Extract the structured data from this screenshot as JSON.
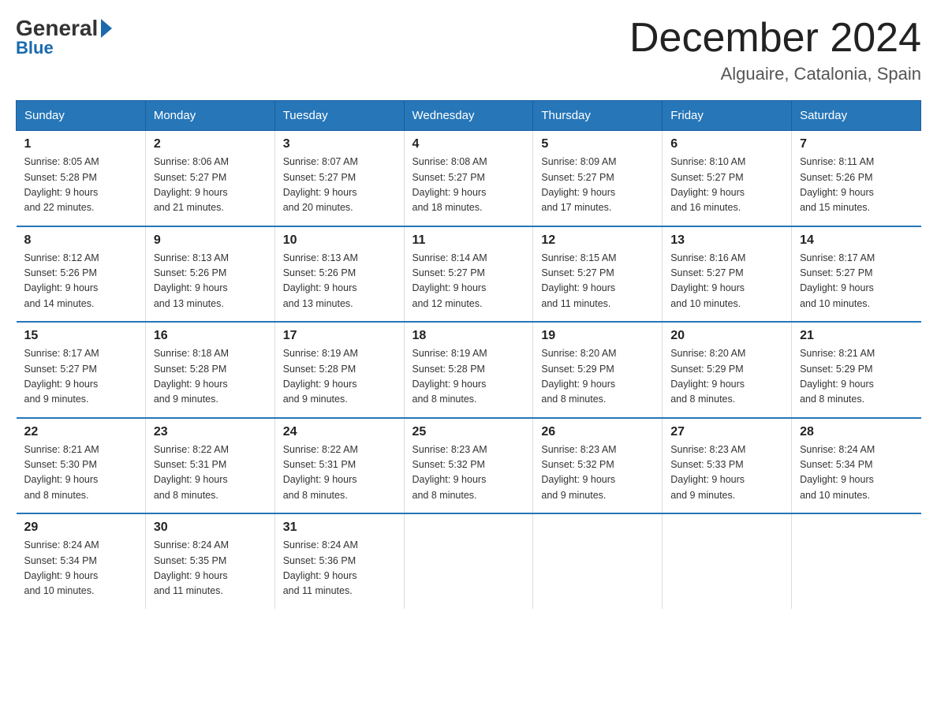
{
  "logo": {
    "general": "General",
    "blue": "Blue"
  },
  "title": "December 2024",
  "location": "Alguaire, Catalonia, Spain",
  "days_of_week": [
    "Sunday",
    "Monday",
    "Tuesday",
    "Wednesday",
    "Thursday",
    "Friday",
    "Saturday"
  ],
  "weeks": [
    [
      {
        "num": "1",
        "info": "Sunrise: 8:05 AM\nSunset: 5:28 PM\nDaylight: 9 hours\nand 22 minutes."
      },
      {
        "num": "2",
        "info": "Sunrise: 8:06 AM\nSunset: 5:27 PM\nDaylight: 9 hours\nand 21 minutes."
      },
      {
        "num": "3",
        "info": "Sunrise: 8:07 AM\nSunset: 5:27 PM\nDaylight: 9 hours\nand 20 minutes."
      },
      {
        "num": "4",
        "info": "Sunrise: 8:08 AM\nSunset: 5:27 PM\nDaylight: 9 hours\nand 18 minutes."
      },
      {
        "num": "5",
        "info": "Sunrise: 8:09 AM\nSunset: 5:27 PM\nDaylight: 9 hours\nand 17 minutes."
      },
      {
        "num": "6",
        "info": "Sunrise: 8:10 AM\nSunset: 5:27 PM\nDaylight: 9 hours\nand 16 minutes."
      },
      {
        "num": "7",
        "info": "Sunrise: 8:11 AM\nSunset: 5:26 PM\nDaylight: 9 hours\nand 15 minutes."
      }
    ],
    [
      {
        "num": "8",
        "info": "Sunrise: 8:12 AM\nSunset: 5:26 PM\nDaylight: 9 hours\nand 14 minutes."
      },
      {
        "num": "9",
        "info": "Sunrise: 8:13 AM\nSunset: 5:26 PM\nDaylight: 9 hours\nand 13 minutes."
      },
      {
        "num": "10",
        "info": "Sunrise: 8:13 AM\nSunset: 5:26 PM\nDaylight: 9 hours\nand 13 minutes."
      },
      {
        "num": "11",
        "info": "Sunrise: 8:14 AM\nSunset: 5:27 PM\nDaylight: 9 hours\nand 12 minutes."
      },
      {
        "num": "12",
        "info": "Sunrise: 8:15 AM\nSunset: 5:27 PM\nDaylight: 9 hours\nand 11 minutes."
      },
      {
        "num": "13",
        "info": "Sunrise: 8:16 AM\nSunset: 5:27 PM\nDaylight: 9 hours\nand 10 minutes."
      },
      {
        "num": "14",
        "info": "Sunrise: 8:17 AM\nSunset: 5:27 PM\nDaylight: 9 hours\nand 10 minutes."
      }
    ],
    [
      {
        "num": "15",
        "info": "Sunrise: 8:17 AM\nSunset: 5:27 PM\nDaylight: 9 hours\nand 9 minutes."
      },
      {
        "num": "16",
        "info": "Sunrise: 8:18 AM\nSunset: 5:28 PM\nDaylight: 9 hours\nand 9 minutes."
      },
      {
        "num": "17",
        "info": "Sunrise: 8:19 AM\nSunset: 5:28 PM\nDaylight: 9 hours\nand 9 minutes."
      },
      {
        "num": "18",
        "info": "Sunrise: 8:19 AM\nSunset: 5:28 PM\nDaylight: 9 hours\nand 8 minutes."
      },
      {
        "num": "19",
        "info": "Sunrise: 8:20 AM\nSunset: 5:29 PM\nDaylight: 9 hours\nand 8 minutes."
      },
      {
        "num": "20",
        "info": "Sunrise: 8:20 AM\nSunset: 5:29 PM\nDaylight: 9 hours\nand 8 minutes."
      },
      {
        "num": "21",
        "info": "Sunrise: 8:21 AM\nSunset: 5:29 PM\nDaylight: 9 hours\nand 8 minutes."
      }
    ],
    [
      {
        "num": "22",
        "info": "Sunrise: 8:21 AM\nSunset: 5:30 PM\nDaylight: 9 hours\nand 8 minutes."
      },
      {
        "num": "23",
        "info": "Sunrise: 8:22 AM\nSunset: 5:31 PM\nDaylight: 9 hours\nand 8 minutes."
      },
      {
        "num": "24",
        "info": "Sunrise: 8:22 AM\nSunset: 5:31 PM\nDaylight: 9 hours\nand 8 minutes."
      },
      {
        "num": "25",
        "info": "Sunrise: 8:23 AM\nSunset: 5:32 PM\nDaylight: 9 hours\nand 8 minutes."
      },
      {
        "num": "26",
        "info": "Sunrise: 8:23 AM\nSunset: 5:32 PM\nDaylight: 9 hours\nand 9 minutes."
      },
      {
        "num": "27",
        "info": "Sunrise: 8:23 AM\nSunset: 5:33 PM\nDaylight: 9 hours\nand 9 minutes."
      },
      {
        "num": "28",
        "info": "Sunrise: 8:24 AM\nSunset: 5:34 PM\nDaylight: 9 hours\nand 10 minutes."
      }
    ],
    [
      {
        "num": "29",
        "info": "Sunrise: 8:24 AM\nSunset: 5:34 PM\nDaylight: 9 hours\nand 10 minutes."
      },
      {
        "num": "30",
        "info": "Sunrise: 8:24 AM\nSunset: 5:35 PM\nDaylight: 9 hours\nand 11 minutes."
      },
      {
        "num": "31",
        "info": "Sunrise: 8:24 AM\nSunset: 5:36 PM\nDaylight: 9 hours\nand 11 minutes."
      },
      {
        "num": "",
        "info": ""
      },
      {
        "num": "",
        "info": ""
      },
      {
        "num": "",
        "info": ""
      },
      {
        "num": "",
        "info": ""
      }
    ]
  ]
}
